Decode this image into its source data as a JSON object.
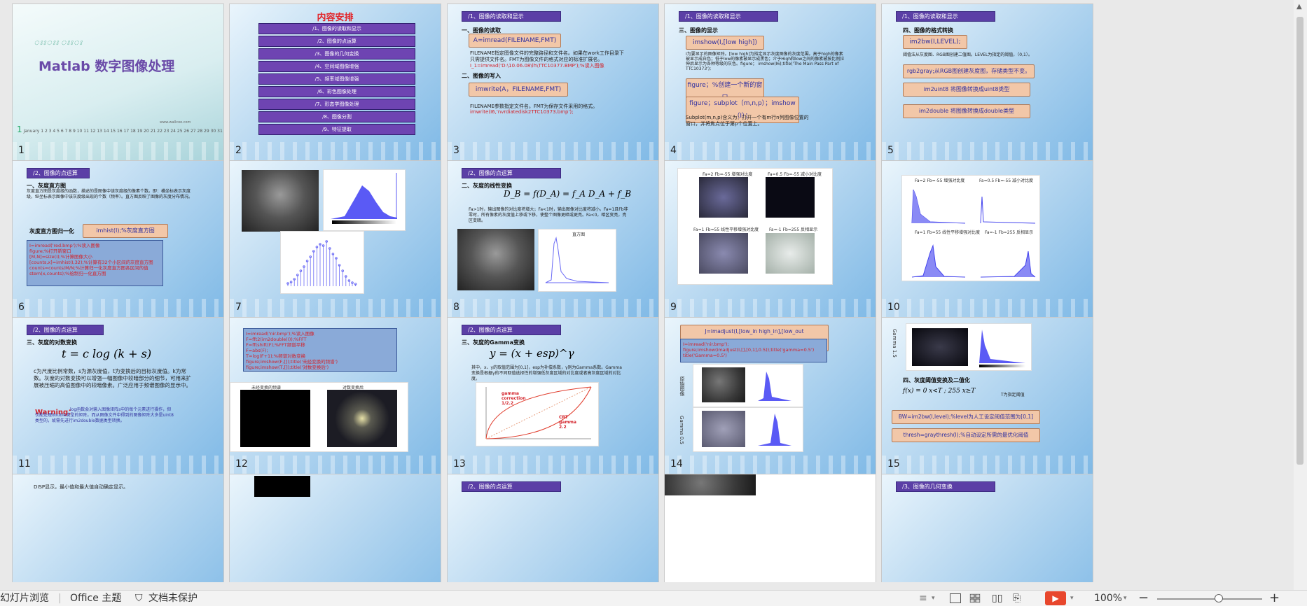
{
  "slides": [
    {
      "n": "1",
      "title": "Matlab  数字图像处理",
      "subtitle": "January",
      "website": "www.wallcoo.com"
    },
    {
      "n": "2",
      "title": "内容安排",
      "toc": [
        "/1、图像的读取和显示",
        "/2、图像的点运算",
        "/3、图像的几何变换",
        "/4、空间域图像增强",
        "/5、频率域图像增强",
        "/6、彩色图像处理",
        "/7、形态学图像处理",
        "/8、图像分割",
        "/9、特征提取"
      ]
    },
    {
      "n": "3",
      "header": "/1、图像的读取和显示",
      "s1": "一、图像的读取",
      "box1": "A=imread(FILENAME,FMT)",
      "t1": "FILENAME指定图像文件的完整路径和文件名。如果在work工作目录下只需提供文件名。FMT为图像文件的格式对应的标准扩展名。",
      "t1red": "I_1=imread('D:\\10.06.08\\lh\\TTC10377.BMP');%读入图像",
      "s2": "二、图像的写入",
      "box2": "imwrite(A，FILENAME,FMT)",
      "t2": "FILENAME参数指定文件名。FMT为保存文件采用的格式。",
      "t2red": "imwrite(I6,'nvrdiatedisk2TTC10373.bmp');"
    },
    {
      "n": "4",
      "header": "/1、图像的读取和显示",
      "s1": "三、图像的显示",
      "box1": "imshow(I,[low high])",
      "t1": "I为要显示的图像矩阵。[low high]为指定显示灰度图像的灰度范围。高于high的像素被显示成白色；低于low的像素被显示成黑色；介于High和low之间的像素被按比例拉伸后显示为各种等级的灰色。figure； imshow(I6);title('The Main Pass Part of TTC10373');",
      "box2": "figure；%创建一个新的窗口",
      "box3": "figure；subplot（m,n,p）；imshow（I）；",
      "t2": "Subplot(m,n,p)含义为：打开一个有m行n列图像位置的窗口，并将焦点位于第p个位置上。"
    },
    {
      "n": "5",
      "header": "/1、图像的读取和显示",
      "s1": "四、图像的格式转换",
      "box1": "im2bw(I,LEVEL);",
      "t1": "阈值法从灰度图、RGB图创建二值图。LEVEL为指定的阈值，（0,1）。",
      "box2": "rgb2gray;从RGB图创建灰度图，存储类型不变。",
      "box3": "im2uint8   将图像转换成uint8类型",
      "box4": "im2double   将图像转换成double类型"
    },
    {
      "n": "6",
      "header": "/2、图像的点运算",
      "s1": "一、灰度直方图",
      "t1": "灰度直方图是灰度级的函数，描述的是图像中该灰度级的像素个数。即：横坐标表示灰度级，纵坐标表示图像中该灰度级出现的个数（频率）。直方图反映了图像的灰度分布情况。",
      "s2": "灰度直方图归一化",
      "box1": "imhist(I);%灰度直方图",
      "code": [
        "I=imread('red.bmp');%读入图像",
        "figure;%打开新窗口",
        "[M,N]=size(I);%计算图像大小",
        "[counts,x]=imhist(I,32);%计算有32个小区间的灰度直方图",
        "counts=counts/M/N;%计算归一化灰度直方图各区间的值",
        "stem(x,counts);%绘制归一化直方图"
      ]
    },
    {
      "n": "7"
    },
    {
      "n": "8",
      "header": "/2、图像的点运算",
      "s1": "二、灰度的线性变换",
      "formula": "D_B = f(D_A) = f_A D_A + f_B",
      "t1": "Fa>1时，输出图像的对比度将增大；Fa<1时，输出图像对比度将减小。Fa=1且Fb非零时，所有像素的灰度值上移或下移，使整个图像更暗或更亮。Fa<0，暗区变亮，亮区变暗。",
      "plot_title": "直方图"
    },
    {
      "n": "9",
      "labels": [
        "Fa=2 Fb=-55 增强对比度",
        "Fa=0.5 Fb=-55 减小对比度",
        "Fa=1 Fb=55 线性平移增强对比度",
        "Fa=-1 Fb=255 反相显示"
      ]
    },
    {
      "n": "10",
      "labels": [
        "Fa=2 Fb=-55 增强对比度",
        "Fa=0.5 Fb=-55 减小对比度",
        "Fa=1 Fb=55 线性平移增强对比度",
        "Fa=-1 Fb=255 反相显示"
      ]
    },
    {
      "n": "11",
      "header": "/2、图像的点运算",
      "s1": "三、灰度的对数变换",
      "formula": "t = c log (k + s)",
      "t1": "c为尺度比例常数，s为源灰度值，t为变换后的目标灰度值。k为常数。灰度的对数变换可以增强一幅图像中较暗部分的细节，可用来扩展被压缩的高值图像中的较暗像素。广泛应用于频谱图像的显示中。",
      "warn": "Warning：",
      "t2": "log函数会对输入图像矩阵s中的每个元素进行操作，但仅能处理double类型的矩阵。而从图像文件中得到的图像矩阵大多是uint8类型的，故需先进行im2double数据类型转换。"
    },
    {
      "n": "12",
      "code": [
        "I=imread('nir.bmp');%读入图像",
        "F=fft2(im2double(I));%FFT",
        "F=fftshift(F);%FFT频谱平移",
        "F=abs(F);",
        "T=log(F+1);%频谱对数变换",
        "figure;imshow(F,[]);title('未经变换的频谱')",
        "figure;imshow(T,[]);title('对数变换后')"
      ],
      "cap1": "未经变换的频谱",
      "cap2": "对数变换后"
    },
    {
      "n": "13",
      "header": "/2、图像的点运算",
      "s1": "三、灰度的Gamma变换",
      "formula": "y = (x + esp)^γ",
      "t1": "其中，x、y的取值范围为[0,1]，esp为补偿系数，γ则为Gamma系数。Gamma变换是根据γ的不同取值选择性的增强低灰度区域的对比度或者高灰度区域的对比度。",
      "lbl1": "gamma correction 1/2.2",
      "lbl2": "CRT gamma 2.2"
    },
    {
      "n": "14",
      "box1": "J=imadjust(I,[low_in  high_in],[low_out  high_out],gamma)",
      "code": [
        "I=imread('nir.bmp');",
        "figure;imshow(imadjust(I,[],[0,1],0.5));title('gamma=0.5')",
        "title('Gamma=0.5')"
      ],
      "side1": "原始图像",
      "side2": "Gamma  0.5"
    },
    {
      "n": "15",
      "side": "Gamma 1.5",
      "s1": "四、灰度阈值变换及二值化",
      "formula": "f(x) = 0 x<T ; 255 x≥T",
      "note": "T为指定阈值",
      "box1": "BW=im2bw(I,level);%level为人工设定阈值范围为[0,1]",
      "box2": "thresh=graythresh(I);%自动设定所需的最优化阈值"
    }
  ],
  "row4": {
    "h3": "/2、图像的点运算",
    "t": "DISP显示，最小值和最大值自动确定显示。",
    "h5": "/3、图像的几何变换"
  },
  "status": {
    "left1": "幻灯片浏览",
    "left2": "Office 主题",
    "left3": "文档未保护",
    "zoom": "100%"
  },
  "colors": {
    "accent": "#5b3fa6",
    "boxFill": "#f2c7a8",
    "red": "#d3222a",
    "play": "#e8472d"
  }
}
